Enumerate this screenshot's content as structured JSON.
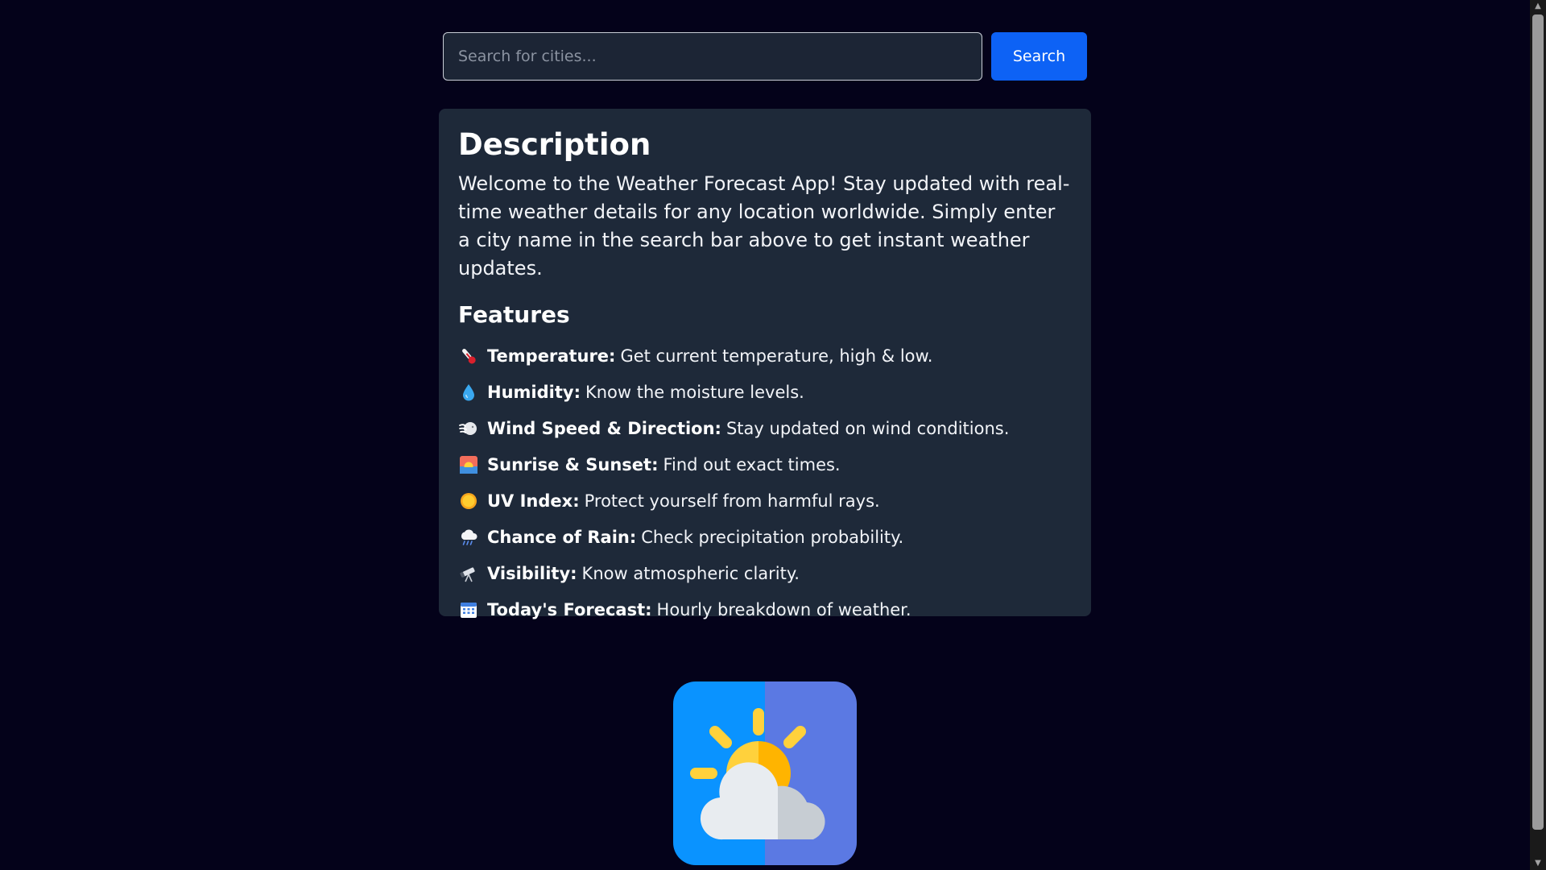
{
  "search": {
    "placeholder": "Search for cities...",
    "button_label": "Search"
  },
  "description": {
    "heading": "Description",
    "text": "Welcome to the Weather Forecast App! Stay updated with real-time weather details for any location worldwide. Simply enter a city name in the search bar above to get instant weather updates."
  },
  "features": {
    "heading": "Features",
    "items": [
      {
        "icon": "thermometer-icon",
        "name": "Temperature:",
        "text": "Get current temperature, high & low."
      },
      {
        "icon": "droplet-icon",
        "name": "Humidity:",
        "text": "Know the moisture levels."
      },
      {
        "icon": "wind-icon",
        "name": "Wind Speed & Direction:",
        "text": "Stay updated on wind conditions."
      },
      {
        "icon": "sunrise-icon",
        "name": "Sunrise & Sunset:",
        "text": "Find out exact times."
      },
      {
        "icon": "sun-icon",
        "name": "UV Index:",
        "text": "Protect yourself from harmful rays."
      },
      {
        "icon": "rain-cloud-icon",
        "name": "Chance of Rain:",
        "text": "Check precipitation probability."
      },
      {
        "icon": "telescope-icon",
        "name": "Visibility:",
        "text": "Know atmospheric clarity."
      },
      {
        "icon": "calendar-icon",
        "name": "Today's Forecast:",
        "text": "Hourly breakdown of weather."
      }
    ]
  },
  "logo": {
    "icon": "partly-cloudy-weather-logo"
  },
  "colors": {
    "background": "#04021a",
    "card": "#1e2939",
    "accent": "#0d62f5"
  }
}
